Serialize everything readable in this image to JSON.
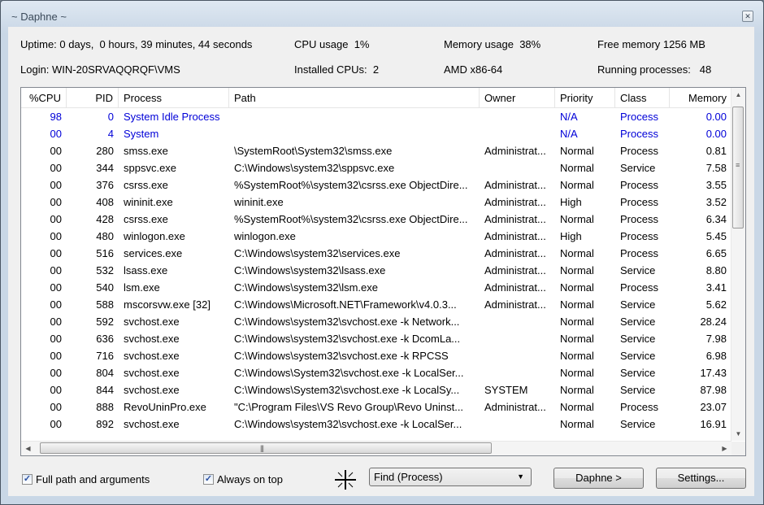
{
  "window": {
    "title": "~ Daphne ~",
    "close_icon": "close-icon"
  },
  "info": {
    "uptime": "Uptime: 0 days,  0 hours, 39 minutes, 44 seconds",
    "cpu_usage": "CPU usage  1%",
    "memory_usage": "Memory usage  38%",
    "free_memory": "Free memory 1256 MB",
    "login": "Login: WIN-20SRVAQQRQF\\VMS",
    "installed_cpus": "Installed CPUs:  2",
    "architecture": "AMD x86-64",
    "running_processes": "Running processes:   48"
  },
  "table": {
    "columns": [
      "%CPU",
      "PID",
      "Process",
      "Path",
      "Owner",
      "Priority",
      "Class",
      "Memory"
    ],
    "rows": [
      {
        "cpu": "98",
        "pid": "0",
        "process": "System Idle Process",
        "path": "",
        "owner": "",
        "priority": "N/A",
        "class": "Process",
        "memory": "0.00",
        "system": true
      },
      {
        "cpu": "00",
        "pid": "4",
        "process": "System",
        "path": "",
        "owner": "",
        "priority": "N/A",
        "class": "Process",
        "memory": "0.00",
        "system": true
      },
      {
        "cpu": "00",
        "pid": "280",
        "process": "smss.exe",
        "path": "\\SystemRoot\\System32\\smss.exe",
        "owner": "Administrat...",
        "priority": "Normal",
        "class": "Process",
        "memory": "0.81"
      },
      {
        "cpu": "00",
        "pid": "344",
        "process": "sppsvc.exe",
        "path": "C:\\Windows\\system32\\sppsvc.exe",
        "owner": "",
        "priority": "Normal",
        "class": "Service",
        "memory": "7.58"
      },
      {
        "cpu": "00",
        "pid": "376",
        "process": "csrss.exe",
        "path": "%SystemRoot%\\system32\\csrss.exe ObjectDire...",
        "owner": "Administrat...",
        "priority": "Normal",
        "class": "Process",
        "memory": "3.55"
      },
      {
        "cpu": "00",
        "pid": "408",
        "process": "wininit.exe",
        "path": "wininit.exe",
        "owner": "Administrat...",
        "priority": "High",
        "class": "Process",
        "memory": "3.52"
      },
      {
        "cpu": "00",
        "pid": "428",
        "process": "csrss.exe",
        "path": "%SystemRoot%\\system32\\csrss.exe ObjectDire...",
        "owner": "Administrat...",
        "priority": "Normal",
        "class": "Process",
        "memory": "6.34"
      },
      {
        "cpu": "00",
        "pid": "480",
        "process": "winlogon.exe",
        "path": "winlogon.exe",
        "owner": "Administrat...",
        "priority": "High",
        "class": "Process",
        "memory": "5.45"
      },
      {
        "cpu": "00",
        "pid": "516",
        "process": "services.exe",
        "path": "C:\\Windows\\system32\\services.exe",
        "owner": "Administrat...",
        "priority": "Normal",
        "class": "Process",
        "memory": "6.65"
      },
      {
        "cpu": "00",
        "pid": "532",
        "process": "lsass.exe",
        "path": "C:\\Windows\\system32\\lsass.exe",
        "owner": "Administrat...",
        "priority": "Normal",
        "class": "Service",
        "memory": "8.80"
      },
      {
        "cpu": "00",
        "pid": "540",
        "process": "lsm.exe",
        "path": "C:\\Windows\\system32\\lsm.exe",
        "owner": "Administrat...",
        "priority": "Normal",
        "class": "Process",
        "memory": "3.41"
      },
      {
        "cpu": "00",
        "pid": "588",
        "process": "mscorsvw.exe [32]",
        "path": "C:\\Windows\\Microsoft.NET\\Framework\\v4.0.3...",
        "owner": "Administrat...",
        "priority": "Normal",
        "class": "Service",
        "memory": "5.62"
      },
      {
        "cpu": "00",
        "pid": "592",
        "process": "svchost.exe",
        "path": "C:\\Windows\\system32\\svchost.exe -k Network...",
        "owner": "",
        "priority": "Normal",
        "class": "Service",
        "memory": "28.24"
      },
      {
        "cpu": "00",
        "pid": "636",
        "process": "svchost.exe",
        "path": "C:\\Windows\\system32\\svchost.exe -k DcomLa...",
        "owner": "",
        "priority": "Normal",
        "class": "Service",
        "memory": "7.98"
      },
      {
        "cpu": "00",
        "pid": "716",
        "process": "svchost.exe",
        "path": "C:\\Windows\\system32\\svchost.exe -k RPCSS",
        "owner": "",
        "priority": "Normal",
        "class": "Service",
        "memory": "6.98"
      },
      {
        "cpu": "00",
        "pid": "804",
        "process": "svchost.exe",
        "path": "C:\\Windows\\System32\\svchost.exe -k LocalSer...",
        "owner": "",
        "priority": "Normal",
        "class": "Service",
        "memory": "17.43"
      },
      {
        "cpu": "00",
        "pid": "844",
        "process": "svchost.exe",
        "path": "C:\\Windows\\System32\\svchost.exe -k LocalSy...",
        "owner": "SYSTEM",
        "priority": "Normal",
        "class": "Service",
        "memory": "87.98"
      },
      {
        "cpu": "00",
        "pid": "888",
        "process": "RevoUninPro.exe",
        "path": "\"C:\\Program Files\\VS Revo Group\\Revo Uninst...",
        "owner": "Administrat...",
        "priority": "Normal",
        "class": "Process",
        "memory": "23.07"
      },
      {
        "cpu": "00",
        "pid": "892",
        "process": "svchost.exe",
        "path": "C:\\Windows\\system32\\svchost.exe -k LocalSer...",
        "owner": "",
        "priority": "Normal",
        "class": "Service",
        "memory": "16.91"
      }
    ]
  },
  "footer": {
    "full_path_label": "Full path and arguments",
    "full_path_checked": true,
    "always_on_top_label": "Always on top",
    "always_on_top_checked": true,
    "finder_icon": "crosshair-finder-icon",
    "find_select_value": "Find (Process)",
    "daphne_button": "Daphne >",
    "settings_button": "Settings..."
  },
  "colors": {
    "system_process_text": "#0000d8"
  }
}
